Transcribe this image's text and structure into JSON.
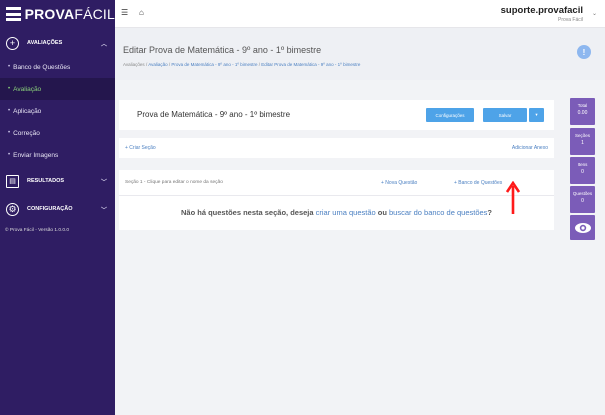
{
  "brand": {
    "bold": "PROVA",
    "thin": "FÁCIL"
  },
  "sidebar": {
    "groups": [
      {
        "label": "AVALIAÇÕES",
        "icon": "plus-circle-icon",
        "chevron": "chevron-up-icon"
      },
      {
        "label": "RESULTADOS",
        "icon": "chart-icon",
        "chevron": "chevron-down-icon"
      },
      {
        "label": "CONFIGURAÇÃO",
        "icon": "gear-icon",
        "chevron": "chevron-down-icon"
      }
    ],
    "items": [
      "Banco de Questões",
      "Avaliação",
      "Aplicação",
      "Correção",
      "Enviar Imagens"
    ],
    "active_item": "Avaliação",
    "version": "© Prova Fácil - Versão 1.0.0.0"
  },
  "topbar": {
    "user": "suporte.provafacil",
    "subtitle": "Prova Fácil"
  },
  "page": {
    "title": "Editar Prova de Matemática - 9º ano - 1º bimestre",
    "breadcrumb_root": "Avaliações",
    "breadcrumb_sep": " / ",
    "breadcrumb_link1": "Avaliação",
    "breadcrumb_link2": "Prova de Matemática - 9º ano - 1º bimestre",
    "breadcrumb_link3": "Editar Prova de Matemática - 9º ano - 1º bimestre"
  },
  "exam": {
    "title": "Prova de Matemática - 9º ano - 1º bimestre",
    "config_button": "Configurações",
    "save_button": "Salvar",
    "create_section": "+ Criar Seção",
    "add_attachment": "Adicionar Anexo"
  },
  "section": {
    "label": "Seção 1 - Clique para editar o nome da seção",
    "new_question": "+ Nova Questão",
    "bank_questions": "+ Banco de Questões",
    "msg_part1": "Não há questões nesta seção, deseja ",
    "msg_link1": "criar uma questão",
    "msg_part2": " ou ",
    "msg_link2": "buscar do banco de questões",
    "msg_part3": "?"
  },
  "stats": [
    {
      "label": "Total",
      "value": "0.00"
    },
    {
      "label": "Seções",
      "value": "1"
    },
    {
      "label": "Itens",
      "value": "0"
    },
    {
      "label": "Questões",
      "value": "0"
    }
  ],
  "colors": {
    "sidebar": "#2f1d63",
    "active": "#8ad17a",
    "accent": "#4ea3e8",
    "stat": "#7b5cb8",
    "arrow": "#ff1a1a"
  }
}
